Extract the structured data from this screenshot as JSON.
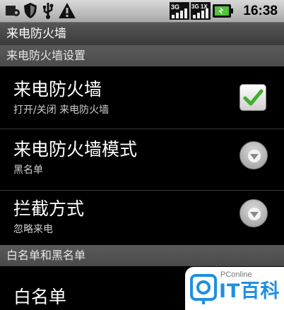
{
  "status_bar": {
    "time": "16:38",
    "icons": [
      "usb-debug-icon",
      "shield-icon",
      "usb-icon",
      "warning-icon",
      "3g-signal-icon",
      "3g-1x-signal-icon",
      "battery-icon"
    ],
    "network_label_1": "3G",
    "network_label_2": "3G 1X"
  },
  "title_bar": {
    "title": "来电防火墙"
  },
  "categories": [
    {
      "label": "来电防火墙设置"
    },
    {
      "label": "白名单和黑名单"
    }
  ],
  "preferences": [
    {
      "title": "来电防火墙",
      "summary": "打开/关闭 来电防火墙",
      "widget": "checkbox",
      "checked": true
    },
    {
      "title": "来电防火墙模式",
      "summary": "黑名单",
      "widget": "dropdown"
    },
    {
      "title": "拦截方式",
      "summary": "忽略来电",
      "widget": "dropdown"
    },
    {
      "title": "白名单",
      "summary": "",
      "widget": "none"
    }
  ],
  "watermark": {
    "small_text": "PConline",
    "big_text": "IT百科"
  },
  "colors": {
    "accent_check": "#3fae2a",
    "watermark_blue": "#1f8fe0"
  }
}
